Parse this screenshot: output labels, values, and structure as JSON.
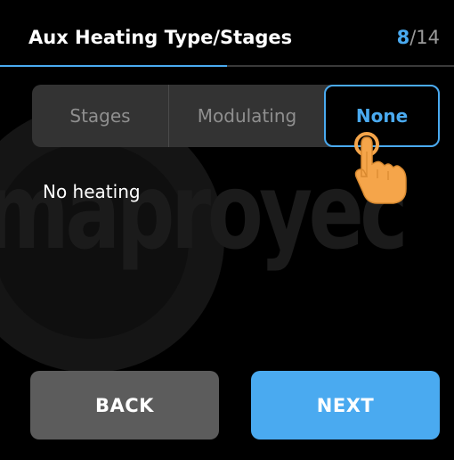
{
  "header": {
    "title": "Aux Heating Type/Stages",
    "step_current": "8",
    "step_total": "/14",
    "progress_fraction": 0.5
  },
  "options": {
    "items": [
      {
        "label": "Stages",
        "selected": false
      },
      {
        "label": "Modulating",
        "selected": false
      },
      {
        "label": "None",
        "selected": true
      }
    ]
  },
  "description": "No heating",
  "watermark": {
    "text": "maproyec"
  },
  "buttons": {
    "back_label": "BACK",
    "next_label": "NEXT"
  },
  "colors": {
    "accent": "#4aaaf0",
    "background": "#000000",
    "segment_bg": "#333333",
    "back_button": "#5c5c5c",
    "hand": "#f5a54a"
  },
  "icons": {
    "pointer": "tap-hand-icon"
  }
}
